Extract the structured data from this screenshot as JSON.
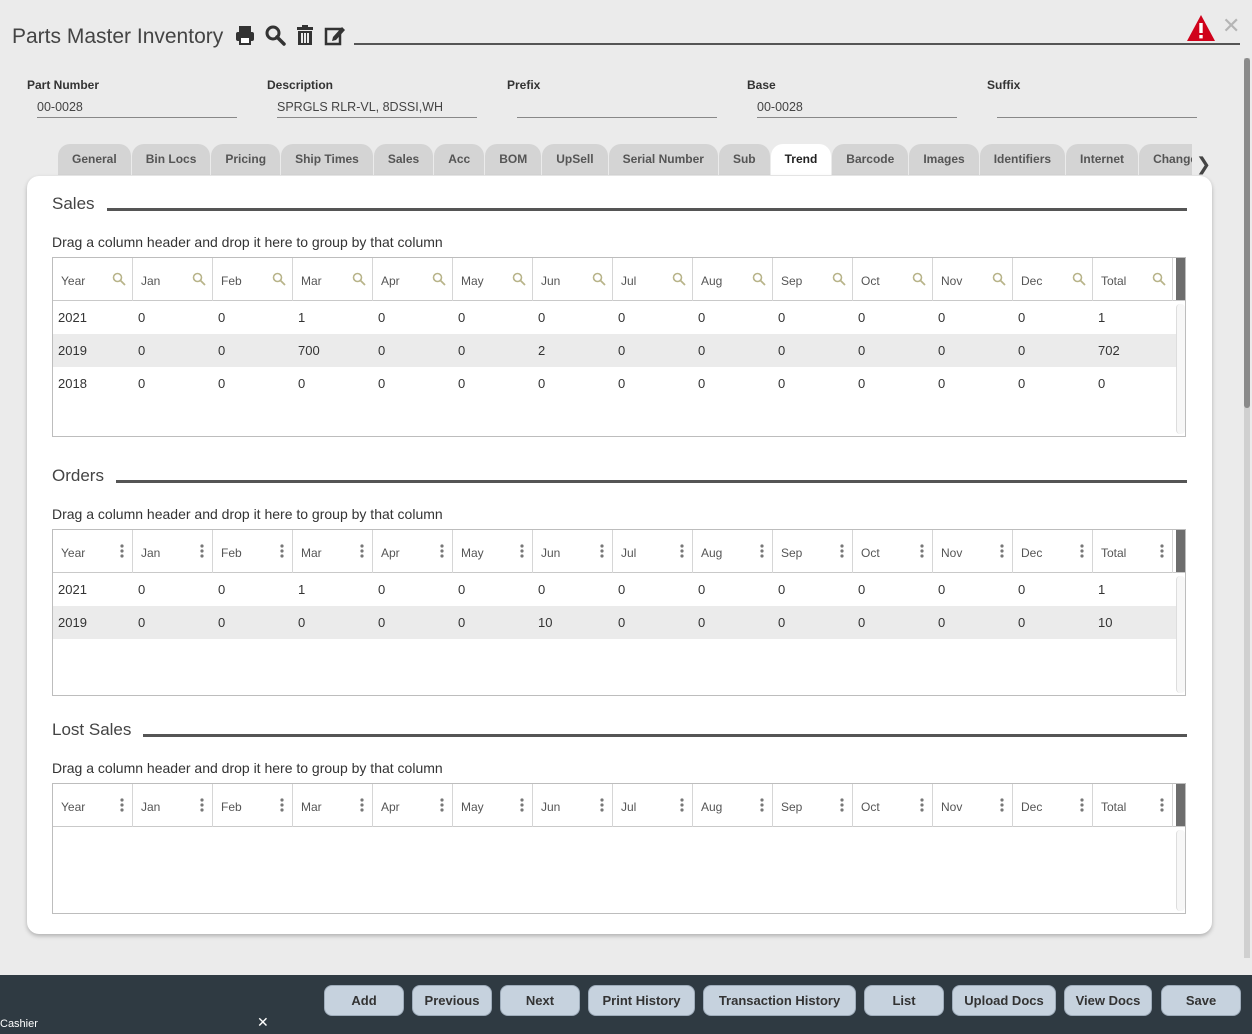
{
  "header": {
    "title": "Parts Master Inventory"
  },
  "fields": [
    {
      "label": "Part Number",
      "value": "00-0028"
    },
    {
      "label": "Description",
      "value": "SPRGLS RLR-VL, 8DSSI,WH"
    },
    {
      "label": "Prefix",
      "value": ""
    },
    {
      "label": "Base",
      "value": "00-0028"
    },
    {
      "label": "Suffix",
      "value": ""
    }
  ],
  "tabs": [
    "General",
    "Bin Locs",
    "Pricing",
    "Ship Times",
    "Sales",
    "Acc",
    "BOM",
    "UpSell",
    "Serial Number",
    "Sub",
    "Trend",
    "Barcode",
    "Images",
    "Identifiers",
    "Internet",
    "Change His"
  ],
  "active_tab": "Trend",
  "columns": [
    "Year",
    "Jan",
    "Feb",
    "Mar",
    "Apr",
    "May",
    "Jun",
    "Jul",
    "Aug",
    "Sep",
    "Oct",
    "Nov",
    "Dec",
    "Total"
  ],
  "group_hint": "Drag a column header and drop it here to group by that column",
  "sections": {
    "sales": {
      "title": "Sales",
      "rows": [
        [
          "2021",
          "0",
          "0",
          "1",
          "0",
          "0",
          "0",
          "0",
          "0",
          "0",
          "0",
          "0",
          "0",
          "1"
        ],
        [
          "2019",
          "0",
          "0",
          "700",
          "0",
          "0",
          "2",
          "0",
          "0",
          "0",
          "0",
          "0",
          "0",
          "702"
        ],
        [
          "2018",
          "0",
          "0",
          "0",
          "0",
          "0",
          "0",
          "0",
          "0",
          "0",
          "0",
          "0",
          "0",
          "0"
        ]
      ]
    },
    "orders": {
      "title": "Orders",
      "rows": [
        [
          "2021",
          "0",
          "0",
          "1",
          "0",
          "0",
          "0",
          "0",
          "0",
          "0",
          "0",
          "0",
          "0",
          "1"
        ],
        [
          "2019",
          "0",
          "0",
          "0",
          "0",
          "0",
          "10",
          "0",
          "0",
          "0",
          "0",
          "0",
          "0",
          "10"
        ]
      ]
    },
    "lost_sales": {
      "title": "Lost Sales",
      "rows": []
    }
  },
  "footer": {
    "buttons": [
      "Add",
      "Previous",
      "Next",
      "Print History",
      "Transaction History",
      "List",
      "Upload Docs",
      "View Docs",
      "Save"
    ],
    "cashier_label": "Cashier"
  },
  "icons": {
    "toolbar": [
      "print-icon",
      "search-icon",
      "trash-icon",
      "edit-icon"
    ],
    "warning": "warning-icon",
    "close": "close-icon"
  },
  "colors": {
    "footer_bg": "#2f3a42",
    "button_bg": "#c6d2de",
    "warning": "#d0021b"
  }
}
